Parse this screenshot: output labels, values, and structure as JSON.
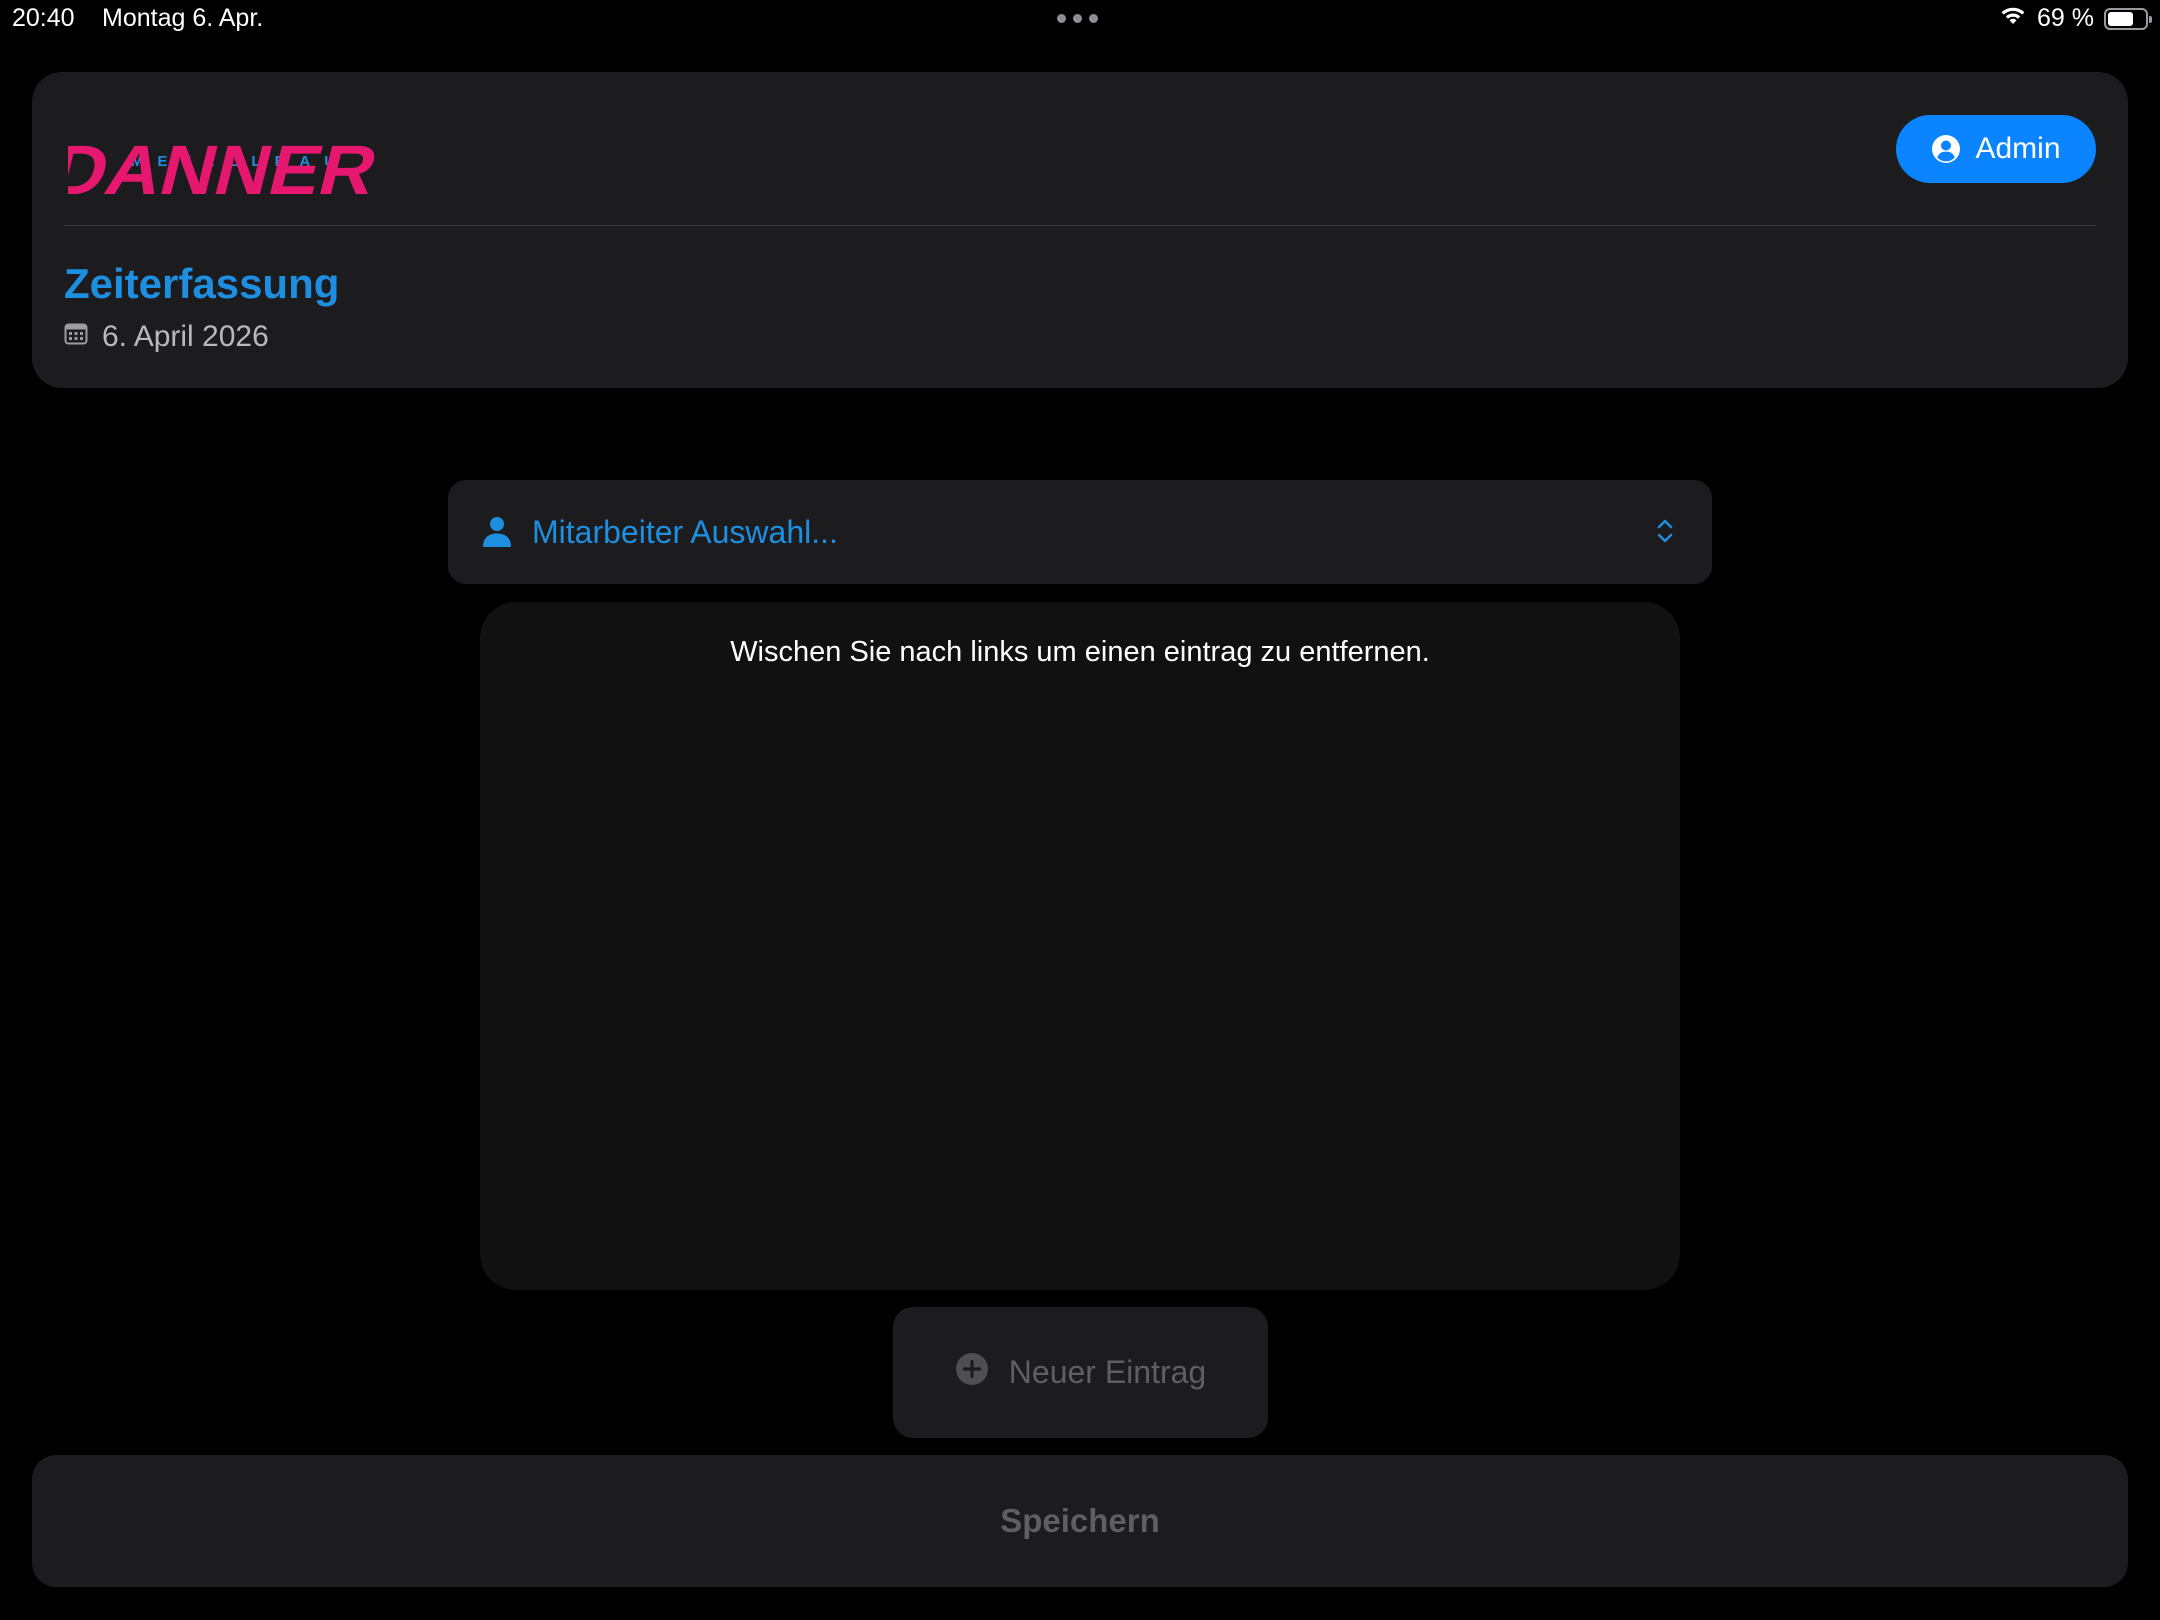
{
  "status_bar": {
    "time": "20:40",
    "date": "Montag 6. Apr.",
    "battery_percent": "69 %",
    "battery_level": 0.69,
    "wifi_icon": "wifi-icon"
  },
  "header": {
    "logo_subtitle": "METALLBAU",
    "logo_name": "DANNER",
    "logo_colors": {
      "name": "#e6176f",
      "subtitle": "#1e8fe0"
    },
    "admin_button_label": "Admin",
    "admin_icon": "person-circle-icon",
    "title": "Zeiterfassung",
    "date": "6. April 2026",
    "date_icon": "calendar-icon"
  },
  "employee_picker": {
    "label": "Mitarbeiter Auswahl...",
    "person_icon": "person-icon",
    "chevron_icon": "chevron-up-down-icon"
  },
  "entries": {
    "hint": "Wischen Sie nach links um einen eintrag zu entfernen.",
    "items": []
  },
  "new_entry_button": {
    "label": "Neuer Eintrag",
    "icon": "plus-circle-icon",
    "enabled": false
  },
  "save_button": {
    "label": "Speichern",
    "enabled": false
  },
  "colors": {
    "background": "#000000",
    "card": "#1c1c1e",
    "accent": "#0a84ff",
    "title_blue": "#1e8fe0",
    "disabled_text": "#5e5e63"
  }
}
